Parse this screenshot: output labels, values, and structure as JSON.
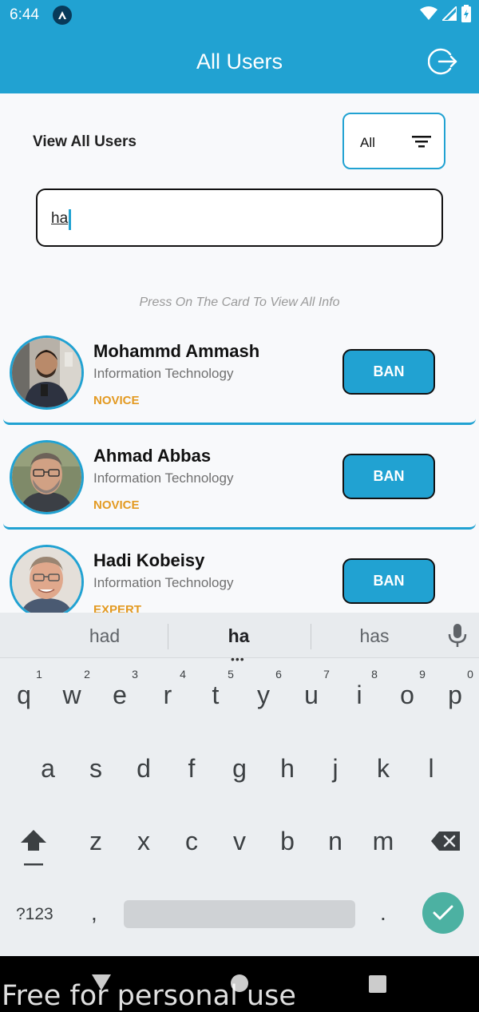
{
  "status_bar": {
    "time": "6:44"
  },
  "app_bar": {
    "title": "All Users"
  },
  "filter": {
    "label": "View All Users",
    "selected": "All"
  },
  "search": {
    "value": "ha"
  },
  "hint": "Press On The Card To View All Info",
  "users": [
    {
      "name": "Mohammd Ammash",
      "department": "Information Technology",
      "level": "NOVICE",
      "action": "BAN"
    },
    {
      "name": "Ahmad Abbas",
      "department": "Information Technology",
      "level": "NOVICE",
      "action": "BAN"
    },
    {
      "name": "Hadi Kobeisy",
      "department": "Information Technology",
      "level": "EXPERT",
      "action": "BAN"
    }
  ],
  "keyboard": {
    "suggestions": [
      "had",
      "ha",
      "has"
    ],
    "row1": [
      "q",
      "w",
      "e",
      "r",
      "t",
      "y",
      "u",
      "i",
      "o",
      "p"
    ],
    "row1_numbers": [
      "1",
      "2",
      "3",
      "4",
      "5",
      "6",
      "7",
      "8",
      "9",
      "0"
    ],
    "row2": [
      "a",
      "s",
      "d",
      "f",
      "g",
      "h",
      "j",
      "k",
      "l"
    ],
    "row3": [
      "z",
      "x",
      "c",
      "v",
      "b",
      "n",
      "m"
    ],
    "symbols_key": "?123",
    "comma": ",",
    "period": "."
  },
  "watermark": "Free for personal use",
  "colors": {
    "primary": "#21a2d2",
    "level": "#e39a22",
    "enter": "#4cb1a2"
  }
}
